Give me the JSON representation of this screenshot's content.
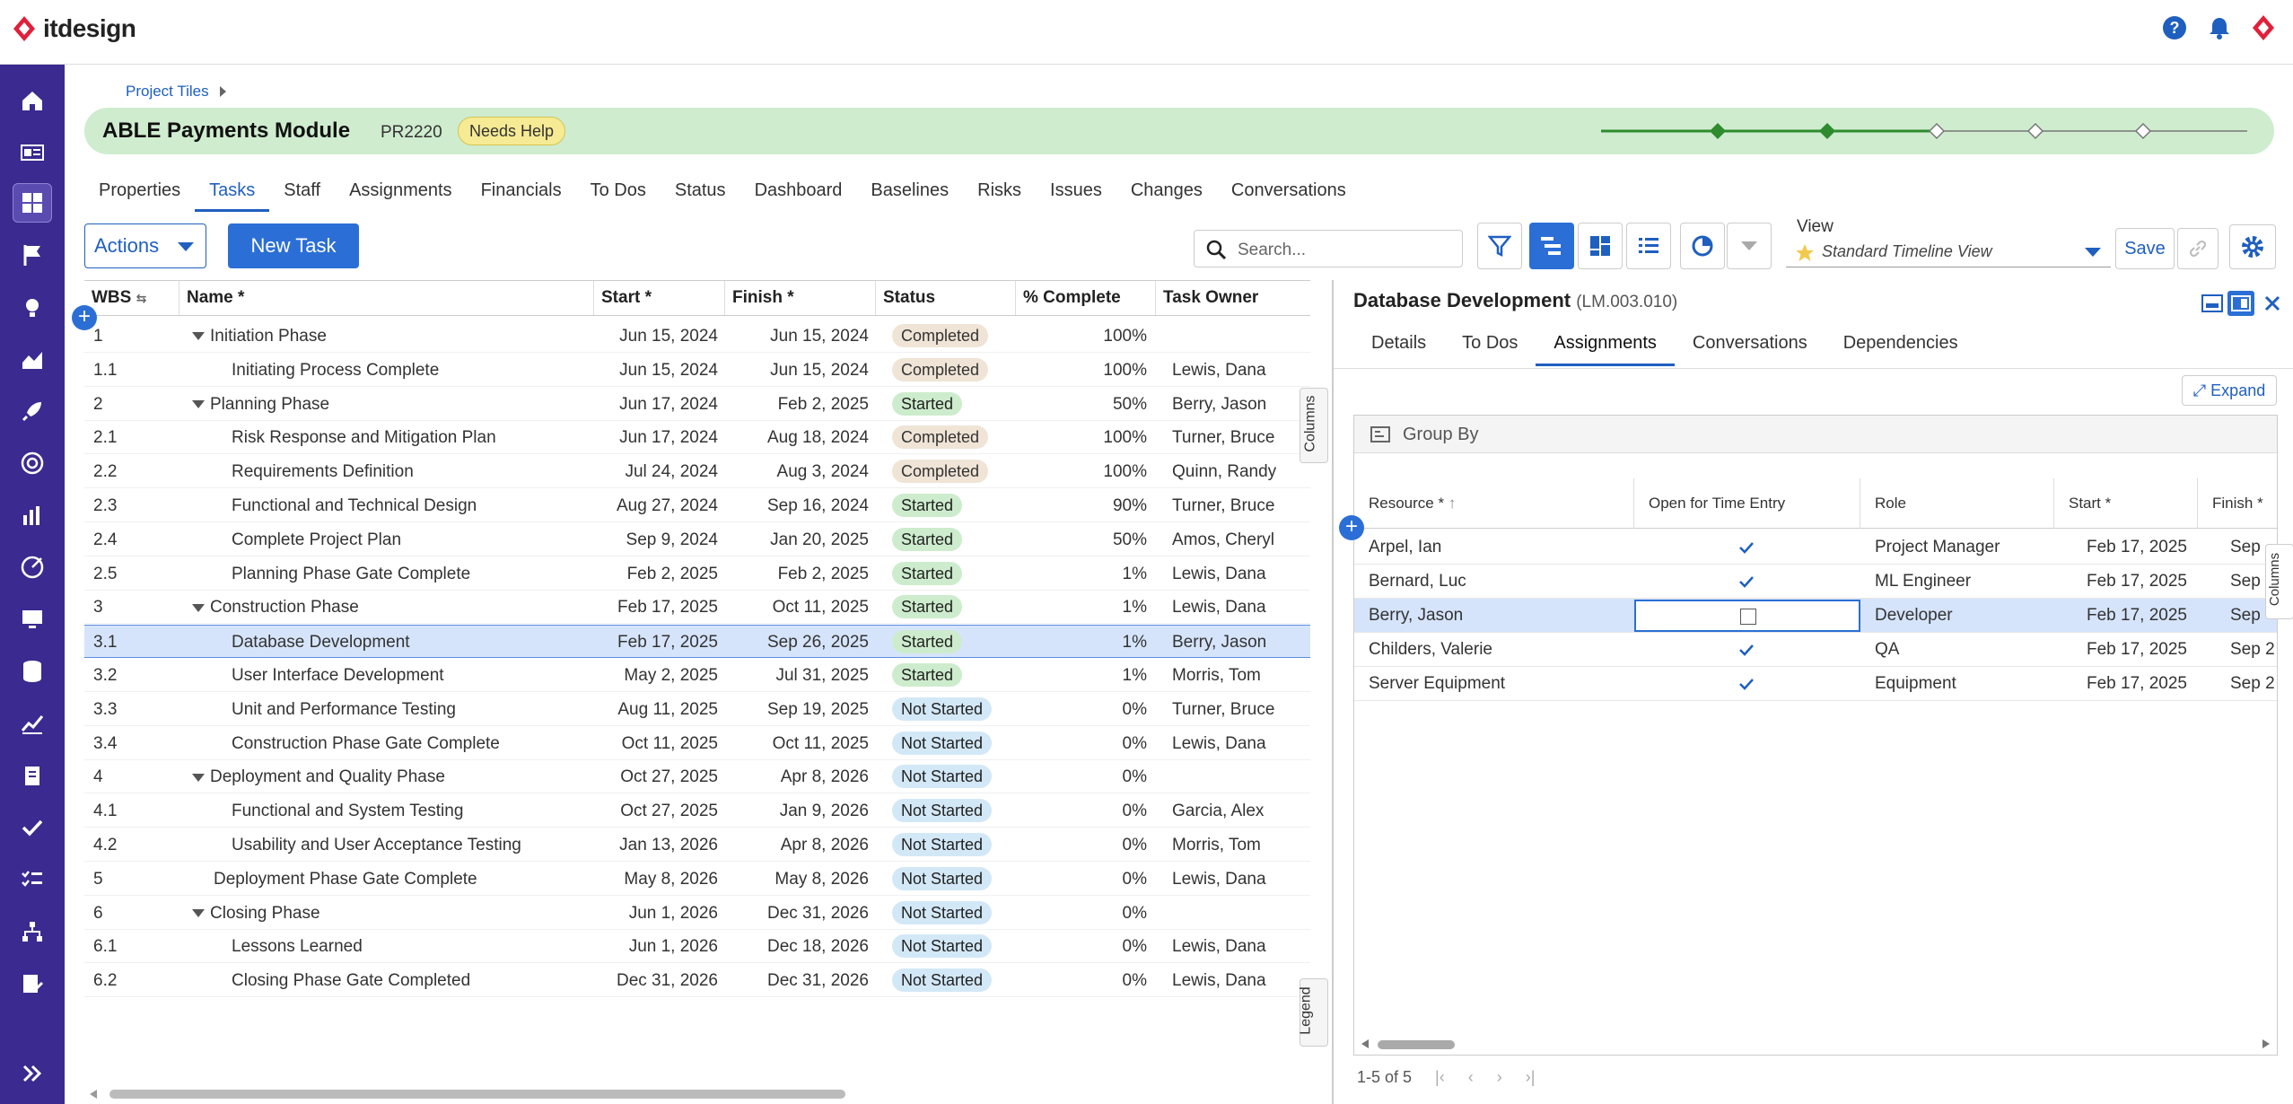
{
  "app": {
    "logo_text": "itdesign"
  },
  "breadcrumb": {
    "label": "Project Tiles"
  },
  "project": {
    "name": "ABLE Payments Module",
    "code": "PR2220",
    "badge": "Needs Help"
  },
  "tabs": [
    "Properties",
    "Tasks",
    "Staff",
    "Assignments",
    "Financials",
    "To Dos",
    "Status",
    "Dashboard",
    "Baselines",
    "Risks",
    "Issues",
    "Changes",
    "Conversations"
  ],
  "active_tab": "Tasks",
  "toolbar": {
    "actions_label": "Actions",
    "new_task_label": "New Task",
    "search_placeholder": "Search...",
    "view_label": "View",
    "view_value": "Standard Timeline View",
    "save_label": "Save"
  },
  "grid": {
    "columns": [
      "WBS",
      "Name",
      "Start",
      "Finish",
      "Status",
      "% Complete",
      "Task Owner"
    ],
    "side_tabs": {
      "columns": "Columns",
      "legend": "Legend"
    },
    "rows": [
      {
        "wbs": "1",
        "name": "Initiation Phase",
        "start": "Jun 15, 2024",
        "finish": "Jun 15, 2024",
        "status": "Completed",
        "pct": "100%",
        "owner": "",
        "level": 0,
        "group": true
      },
      {
        "wbs": "1.1",
        "name": "Initiating Process Complete",
        "start": "Jun 15, 2024",
        "finish": "Jun 15, 2024",
        "status": "Completed",
        "pct": "100%",
        "owner": "Lewis, Dana",
        "level": 1,
        "group": false
      },
      {
        "wbs": "2",
        "name": "Planning Phase",
        "start": "Jun 17, 2024",
        "finish": "Feb 2, 2025",
        "status": "Started",
        "pct": "50%",
        "owner": "Berry, Jason",
        "level": 0,
        "group": true
      },
      {
        "wbs": "2.1",
        "name": "Risk Response and Mitigation Plan",
        "start": "Jun 17, 2024",
        "finish": "Aug 18, 2024",
        "status": "Completed",
        "pct": "100%",
        "owner": "Turner, Bruce",
        "level": 1,
        "group": false
      },
      {
        "wbs": "2.2",
        "name": "Requirements Definition",
        "start": "Jul 24, 2024",
        "finish": "Aug 3, 2024",
        "status": "Completed",
        "pct": "100%",
        "owner": "Quinn, Randy",
        "level": 1,
        "group": false
      },
      {
        "wbs": "2.3",
        "name": "Functional and Technical Design",
        "start": "Aug 27, 2024",
        "finish": "Sep 16, 2024",
        "status": "Started",
        "pct": "90%",
        "owner": "Turner, Bruce",
        "level": 1,
        "group": false
      },
      {
        "wbs": "2.4",
        "name": "Complete Project Plan",
        "start": "Sep 9, 2024",
        "finish": "Jan 20, 2025",
        "status": "Started",
        "pct": "50%",
        "owner": "Amos, Cheryl",
        "level": 1,
        "group": false
      },
      {
        "wbs": "2.5",
        "name": "Planning Phase Gate Complete",
        "start": "Feb 2, 2025",
        "finish": "Feb 2, 2025",
        "status": "Started",
        "pct": "1%",
        "owner": "Lewis, Dana",
        "level": 1,
        "group": false
      },
      {
        "wbs": "3",
        "name": "Construction Phase",
        "start": "Feb 17, 2025",
        "finish": "Oct 11, 2025",
        "status": "Started",
        "pct": "1%",
        "owner": "Lewis, Dana",
        "level": 0,
        "group": true
      },
      {
        "wbs": "3.1",
        "name": "Database Development",
        "start": "Feb 17, 2025",
        "finish": "Sep 26, 2025",
        "status": "Started",
        "pct": "1%",
        "owner": "Berry, Jason",
        "level": 1,
        "group": false,
        "selected": true
      },
      {
        "wbs": "3.2",
        "name": "User Interface Development",
        "start": "May 2, 2025",
        "finish": "Jul 31, 2025",
        "status": "Started",
        "pct": "1%",
        "owner": "Morris, Tom",
        "level": 1,
        "group": false
      },
      {
        "wbs": "3.3",
        "name": "Unit and Performance Testing",
        "start": "Aug 11, 2025",
        "finish": "Sep 19, 2025",
        "status": "Not Started",
        "pct": "0%",
        "owner": "Turner, Bruce",
        "level": 1,
        "group": false
      },
      {
        "wbs": "3.4",
        "name": "Construction Phase Gate Complete",
        "start": "Oct 11, 2025",
        "finish": "Oct 11, 2025",
        "status": "Not Started",
        "pct": "0%",
        "owner": "Lewis, Dana",
        "level": 1,
        "group": false
      },
      {
        "wbs": "4",
        "name": "Deployment and Quality Phase",
        "start": "Oct 27, 2025",
        "finish": "Apr 8, 2026",
        "status": "Not Started",
        "pct": "0%",
        "owner": "",
        "level": 0,
        "group": true
      },
      {
        "wbs": "4.1",
        "name": "Functional and System Testing",
        "start": "Oct 27, 2025",
        "finish": "Jan 9, 2026",
        "status": "Not Started",
        "pct": "0%",
        "owner": "Garcia, Alex",
        "level": 1,
        "group": false
      },
      {
        "wbs": "4.2",
        "name": "Usability and User Acceptance Testing",
        "start": "Jan 13, 2026",
        "finish": "Apr 8, 2026",
        "status": "Not Started",
        "pct": "0%",
        "owner": "Morris, Tom",
        "level": 1,
        "group": false
      },
      {
        "wbs": "5",
        "name": "Deployment Phase Gate Complete",
        "start": "May 8, 2026",
        "finish": "May 8, 2026",
        "status": "Not Started",
        "pct": "0%",
        "owner": "Lewis, Dana",
        "level": 0,
        "group": false
      },
      {
        "wbs": "6",
        "name": "Closing Phase",
        "start": "Jun 1, 2026",
        "finish": "Dec 31, 2026",
        "status": "Not Started",
        "pct": "0%",
        "owner": "",
        "level": 0,
        "group": true
      },
      {
        "wbs": "6.1",
        "name": "Lessons Learned",
        "start": "Jun 1, 2026",
        "finish": "Dec 18, 2026",
        "status": "Not Started",
        "pct": "0%",
        "owner": "Lewis, Dana",
        "level": 1,
        "group": false
      },
      {
        "wbs": "6.2",
        "name": "Closing Phase Gate Completed",
        "start": "Dec 31, 2026",
        "finish": "Dec 31, 2026",
        "status": "Not Started",
        "pct": "0%",
        "owner": "Lewis, Dana",
        "level": 1,
        "group": false
      }
    ]
  },
  "detail": {
    "title": "Database Development",
    "code": "(LM.003.010)",
    "tabs": [
      "Details",
      "To Dos",
      "Assignments",
      "Conversations",
      "Dependencies"
    ],
    "active_tab": "Assignments",
    "expand_label": "Expand",
    "group_by_label": "Group By",
    "columns": [
      "Resource",
      "Open for Time Entry",
      "Role",
      "Start",
      "Finish"
    ],
    "columns_tab": "Columns",
    "rows": [
      {
        "resource": "Arpel, Ian",
        "open": true,
        "role": "Project Manager",
        "start": "Feb 17, 2025",
        "finish": "Sep"
      },
      {
        "resource": "Bernard, Luc",
        "open": true,
        "role": "ML Engineer",
        "start": "Feb 17, 2025",
        "finish": "Sep"
      },
      {
        "resource": "Berry, Jason",
        "open": false,
        "role": "Developer",
        "start": "Feb 17, 2025",
        "finish": "Sep",
        "selected": true
      },
      {
        "resource": "Childers, Valerie",
        "open": true,
        "role": "QA",
        "start": "Feb 17, 2025",
        "finish": "Sep 2"
      },
      {
        "resource": "Server Equipment",
        "open": true,
        "role": "Equipment",
        "start": "Feb 17, 2025",
        "finish": "Sep 2"
      }
    ],
    "pager_text": "1-5 of 5"
  },
  "colors": {
    "brand_purple": "#3b2a8f",
    "accent_blue": "#2b6fd6",
    "logo_red": "#e0203a",
    "project_bar": "#cfeccf",
    "milestone_green": "#2e8b2e"
  },
  "milestones": [
    {
      "done": true
    },
    {
      "done": true
    },
    {
      "done": false
    },
    {
      "done": false
    },
    {
      "done": false
    }
  ]
}
